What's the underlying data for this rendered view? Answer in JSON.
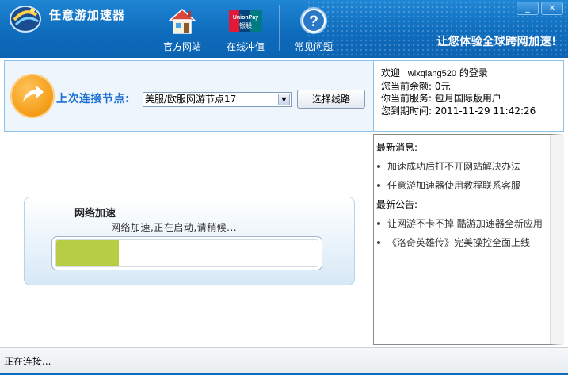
{
  "app": {
    "title": "任意游加速器",
    "slogan": "让您体验全球跨网加速!"
  },
  "nav": [
    {
      "label": "官方网站",
      "icon": "house-icon"
    },
    {
      "label": "在线冲值",
      "icon": "unionpay-icon",
      "card_text_top": "UnionPay",
      "card_text_bottom": "银联"
    },
    {
      "label": "常见问题",
      "icon": "help-icon"
    }
  ],
  "window_controls": {
    "minimize": "_",
    "close": "×"
  },
  "connect": {
    "last_node_label": "上次连接节点:",
    "node_value": "美服/欧服网游节点17",
    "choose_button": "选择线路"
  },
  "user": {
    "welcome_prefix": "欢迎",
    "username": "wlxqiang520",
    "welcome_suffix": "的登录",
    "balance": "您当前余额: 0元",
    "service": "你当前服务: 包月国际版用户",
    "expiry": "您到期时间: 2011-11-29 11:42:26"
  },
  "accelerate": {
    "title": "网络加速",
    "status": "网络加速,正在启动,请稍候...",
    "progress_percent": 24
  },
  "news": {
    "latest_messages_heading": "最新消息:",
    "messages": [
      "加速成功后打不开网站解决办法",
      "任意游加速器使用教程联系客服"
    ],
    "announcements_heading": "最新公告:",
    "announcements": [
      "让网游不卡不掉 酷游加速器全新应用",
      "《洛奇英雄传》完美操控全面上线"
    ]
  },
  "statusbar": {
    "text": "正在连接..."
  },
  "colors": {
    "header_blue": "#0f6cbd",
    "accent_blue": "#1c6fd3",
    "progress_green": "#b7cd45",
    "arrow_orange": "#f39a14"
  }
}
